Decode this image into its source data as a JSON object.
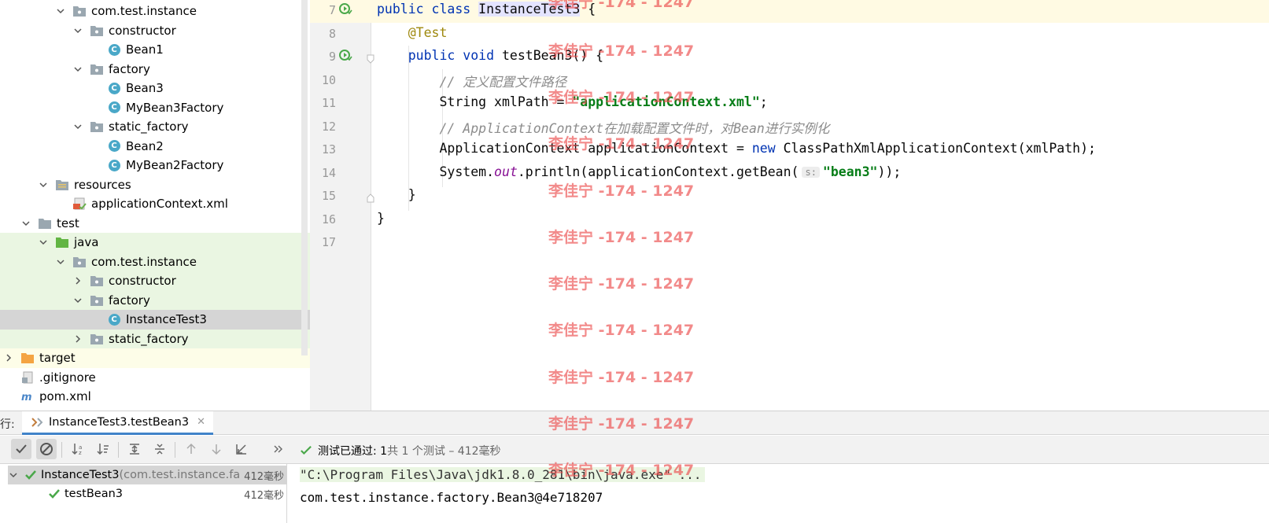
{
  "project_tree": {
    "items": [
      {
        "label": "com.test.instance",
        "type": "package"
      },
      {
        "label": "constructor",
        "type": "package"
      },
      {
        "label": "Bean1",
        "type": "class"
      },
      {
        "label": "factory",
        "type": "package"
      },
      {
        "label": "Bean3",
        "type": "class"
      },
      {
        "label": "MyBean3Factory",
        "type": "class"
      },
      {
        "label": "static_factory",
        "type": "package"
      },
      {
        "label": "Bean2",
        "type": "class"
      },
      {
        "label": "MyBean2Factory",
        "type": "class"
      },
      {
        "label": "resources",
        "type": "resources-folder"
      },
      {
        "label": "applicationContext.xml",
        "type": "xml-file"
      },
      {
        "label": "test",
        "type": "folder"
      },
      {
        "label": "java",
        "type": "test-source-folder"
      },
      {
        "label": "com.test.instance",
        "type": "package"
      },
      {
        "label": "constructor",
        "type": "package"
      },
      {
        "label": "factory",
        "type": "package"
      },
      {
        "label": "InstanceTest3",
        "type": "class",
        "selected": true
      },
      {
        "label": "static_factory",
        "type": "package"
      },
      {
        "label": "target",
        "type": "excluded-folder"
      },
      {
        "label": ".gitignore",
        "type": "gitignore-file"
      },
      {
        "label": "pom.xml",
        "type": "maven-file"
      }
    ]
  },
  "editor": {
    "lines": [
      {
        "num": "7"
      },
      {
        "num": "8"
      },
      {
        "num": "9"
      },
      {
        "num": "10"
      },
      {
        "num": "11"
      },
      {
        "num": "12"
      },
      {
        "num": "13"
      },
      {
        "num": "14"
      },
      {
        "num": "15"
      },
      {
        "num": "16"
      },
      {
        "num": "17"
      }
    ],
    "code": {
      "l7_kw": "public class ",
      "l7_cls": "InstanceTest3",
      "l7_rest": " {",
      "l8_ann": "@Test",
      "l9_kw": "public void ",
      "l9_rest": "testBean3() {",
      "l10_cmt": "// 定义配置文件路径",
      "l11_a": "String xmlPath = ",
      "l11_str": "\"applicationContext.xml\"",
      "l11_b": ";",
      "l12_cmt": "// ApplicationContext在加载配置文件时，对Bean进行实例化",
      "l13_a": "ApplicationContext applicationContext = ",
      "l13_kw": "new ",
      "l13_b": "ClassPathXmlApplicationContext(xmlPath);",
      "l14_a": "System.",
      "l14_fld": "out",
      "l14_b": ".println(applicationContext.getBean(",
      "l14_hint": "s:",
      "l14_str": "\"bean3\"",
      "l14_c": "));",
      "l15": "}",
      "l16": "}"
    }
  },
  "run_window": {
    "label": "行:",
    "tab_title": "InstanceTest3.testBean3",
    "status_prefix": "测试 ",
    "status_passed": "已通过: 1",
    "status_summary": "共 1 个测试 – 412毫秒",
    "test_tree": [
      {
        "name": "InstanceTest3",
        "pkg": " (com.test.instance.fa",
        "time": "412毫秒"
      },
      {
        "name": "testBean3",
        "pkg": "",
        "time": "412毫秒"
      }
    ],
    "console": {
      "cmd_line": "\"C:\\Program Files\\Java\\jdk1.8.0_281\\bin\\java.exe\" ...",
      "output_line": "com.test.instance.factory.Bean3@4e718207"
    }
  },
  "watermark": {
    "text": "李佳宁 -174 - 1247"
  },
  "colors": {
    "keyword": "#0033b3",
    "annotation": "#9e880d",
    "string": "#067d17",
    "comment": "#8c8c8c",
    "pass_green": "#4aa84a",
    "class_icon": "#4aa8c8"
  }
}
